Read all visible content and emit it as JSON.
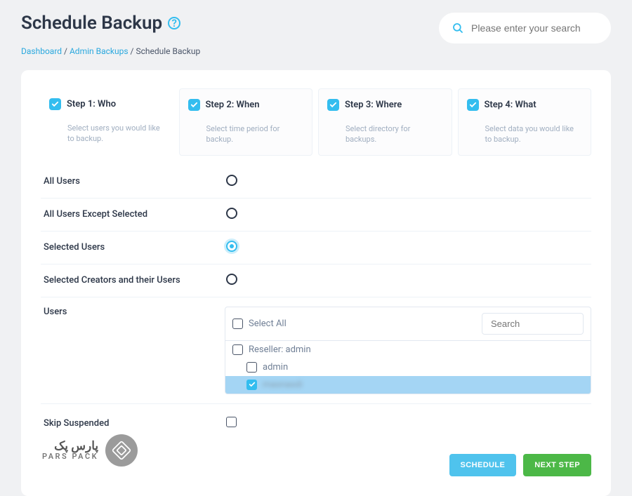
{
  "page": {
    "title": "Schedule Backup"
  },
  "breadcrumb": {
    "dashboard": "Dashboard",
    "admin_backups": "Admin Backups",
    "current": "Schedule Backup",
    "sep": "/"
  },
  "search": {
    "placeholder": "Please enter your search"
  },
  "steps": [
    {
      "title": "Step 1: Who",
      "desc": "Select users you would like to backup."
    },
    {
      "title": "Step 2: When",
      "desc": "Select time period for backup."
    },
    {
      "title": "Step 3: Where",
      "desc": "Select directory for backups."
    },
    {
      "title": "Step 4: What",
      "desc": "Select data you would like to backup."
    }
  ],
  "options": {
    "all_users": "All Users",
    "all_except": "All Users Except Selected",
    "selected_users": "Selected Users",
    "selected_creators": "Selected Creators and their Users"
  },
  "users_section": {
    "label": "Users",
    "select_all": "Select All",
    "search_placeholder": "Search",
    "reseller_admin": "Reseller: admin",
    "user_admin": "admin",
    "user_blur": "masnasdi"
  },
  "skip": {
    "label": "Skip Suspended"
  },
  "actions": {
    "schedule": "SCHEDULE",
    "next": "NEXT STEP"
  },
  "logo": {
    "ar": "پارس پک",
    "en": "PARS PACK"
  },
  "colors": {
    "accent": "#33bdef",
    "green": "#4cb847"
  }
}
